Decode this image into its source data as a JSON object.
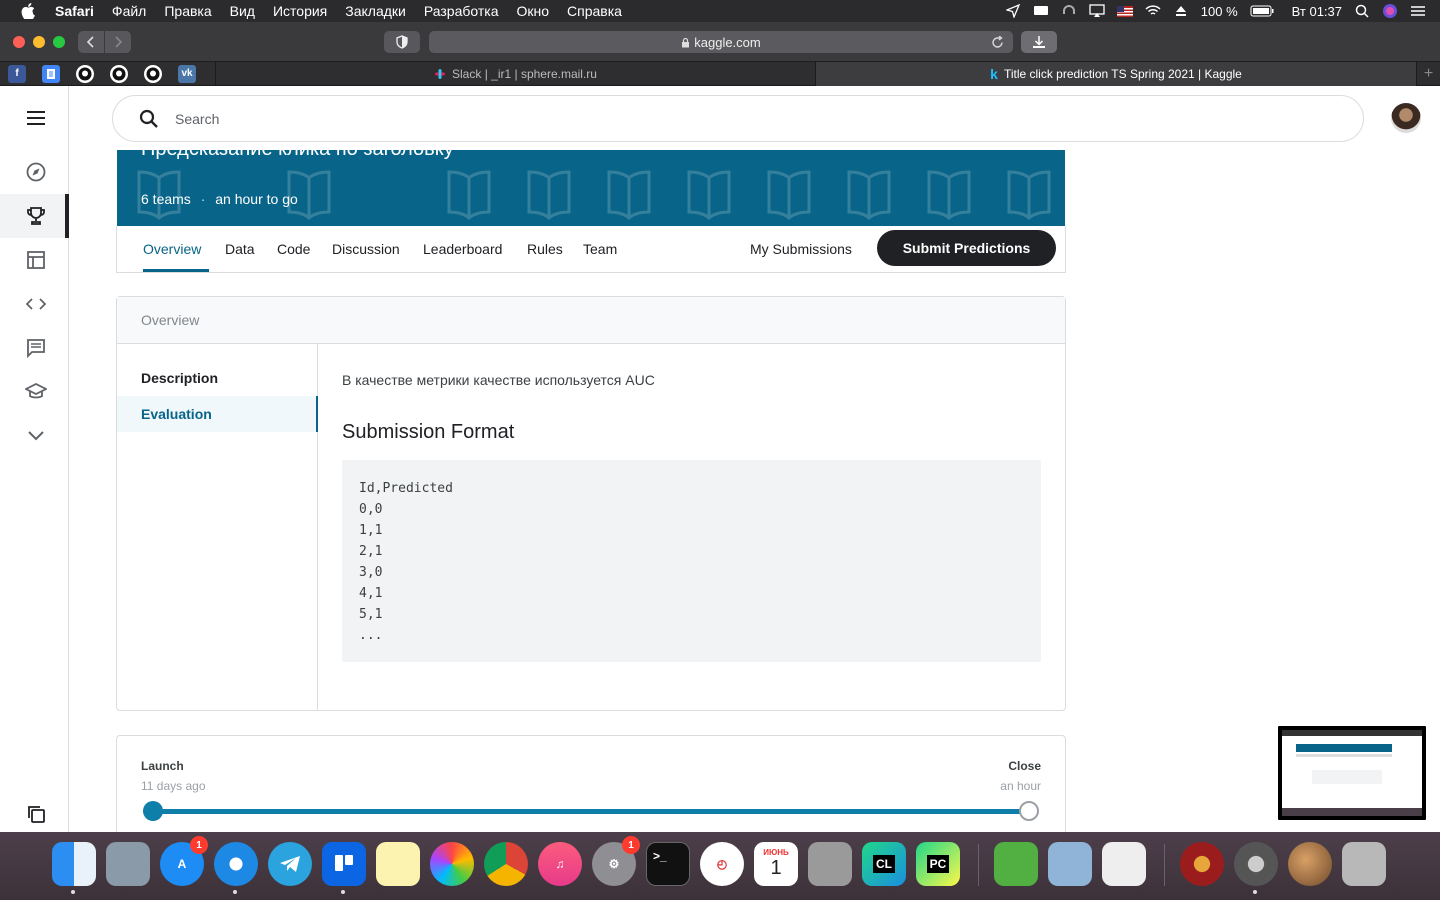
{
  "menubar": {
    "app": "Safari",
    "items": [
      "Файл",
      "Правка",
      "Вид",
      "История",
      "Закладки",
      "Разработка",
      "Окно",
      "Справка"
    ],
    "battery": "100 %",
    "clock": "Вт 01:37"
  },
  "browser": {
    "url": "kaggle.com",
    "tabs": [
      {
        "label": "Slack | _ir1 | sphere.mail.ru"
      },
      {
        "label": "Title click prediction TS Spring 2021 | Kaggle"
      }
    ],
    "favorites": [
      "facebook-icon",
      "docs-icon",
      "github-icon",
      "github-icon",
      "github-icon",
      "vk-icon"
    ]
  },
  "search": {
    "placeholder": "Search"
  },
  "competition": {
    "title": "Предсказание клика по заголовку",
    "teams": "6 teams",
    "separator": "·",
    "time_left": "an hour to go"
  },
  "nav": {
    "tabs": [
      "Overview",
      "Data",
      "Code",
      "Discussion",
      "Leaderboard",
      "Rules",
      "Team"
    ],
    "my_submissions": "My Submissions",
    "submit": "Submit Predictions"
  },
  "overview": {
    "header": "Overview",
    "sections": [
      "Description",
      "Evaluation"
    ],
    "evaluation_text": "В качестве метрики качестве используется AUC",
    "format_heading": "Submission Format",
    "code_lines": [
      "Id,Predicted",
      "0,0",
      "1,1",
      "2,1",
      "3,0",
      "4,1",
      "5,1",
      "..."
    ]
  },
  "timeline": {
    "launch_label": "Launch",
    "launch_sub": "11 days ago",
    "close_label": "Close",
    "close_sub": "an hour",
    "progress": 1.0
  },
  "dock": {
    "appstore_badge": "1",
    "settings_badge": "1",
    "calendar_month": "ИЮНЬ",
    "calendar_day": "1"
  },
  "colors": {
    "accent": "#086488",
    "dark": "#202124"
  }
}
